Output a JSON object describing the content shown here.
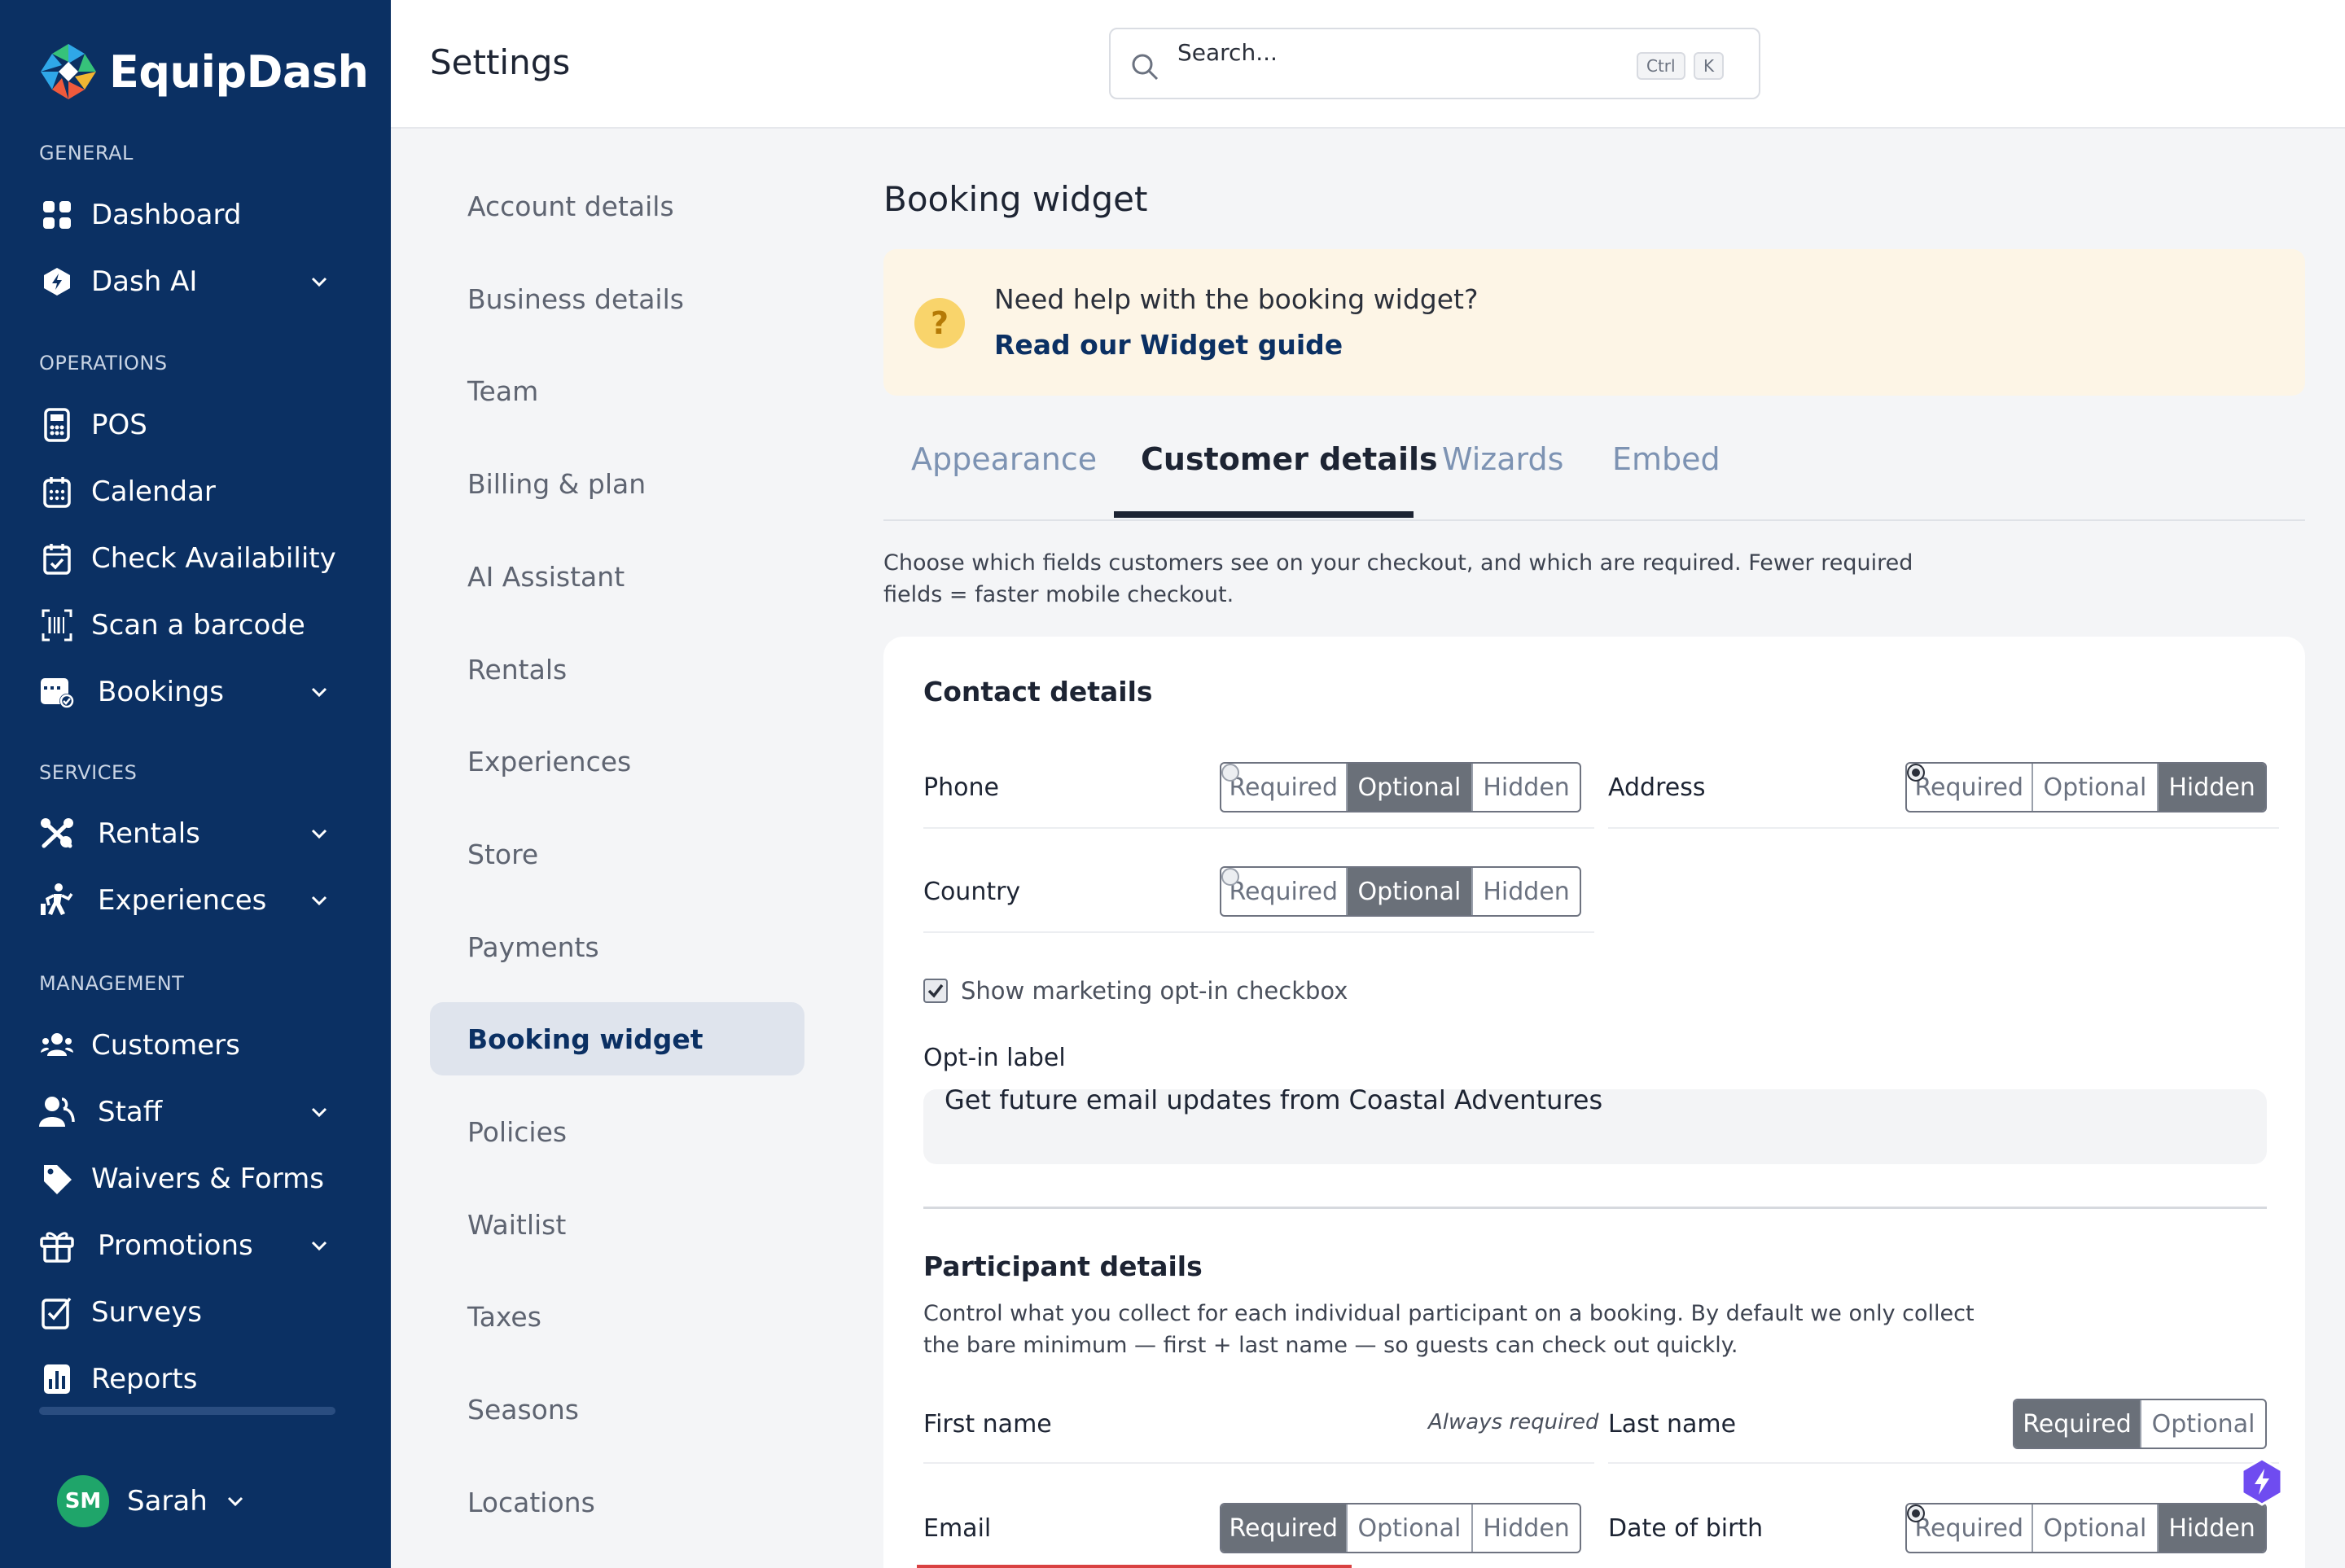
{
  "app": {
    "name": "EquipDash"
  },
  "sidebar": {
    "sections": [
      {
        "label": "GENERAL",
        "items": [
          {
            "label": "Dashboard",
            "icon": "grid-icon",
            "has_chevron": false
          },
          {
            "label": "Dash AI",
            "icon": "ai-hexagon-icon",
            "has_chevron": true
          }
        ]
      },
      {
        "label": "OPERATIONS",
        "items": [
          {
            "label": "POS",
            "icon": "pos-terminal-icon",
            "has_chevron": false
          },
          {
            "label": "Calendar",
            "icon": "calendar-icon",
            "has_chevron": false
          },
          {
            "label": "Check Availability",
            "icon": "calendar-check-icon",
            "has_chevron": false
          },
          {
            "label": "Scan a barcode",
            "icon": "barcode-scan-icon",
            "has_chevron": false
          },
          {
            "label": "Bookings",
            "icon": "bookings-icon",
            "has_chevron": true
          }
        ]
      },
      {
        "label": "SERVICES",
        "items": [
          {
            "label": "Rentals",
            "icon": "rentals-icon",
            "has_chevron": true
          },
          {
            "label": "Experiences",
            "icon": "experiences-icon",
            "has_chevron": true
          }
        ]
      },
      {
        "label": "MANAGEMENT",
        "items": [
          {
            "label": "Customers",
            "icon": "customers-icon",
            "has_chevron": false
          },
          {
            "label": "Staff",
            "icon": "staff-icon",
            "has_chevron": true
          },
          {
            "label": "Waivers & Forms",
            "icon": "tag-icon",
            "has_chevron": false
          },
          {
            "label": "Promotions",
            "icon": "gift-icon",
            "has_chevron": true
          },
          {
            "label": "Surveys",
            "icon": "survey-icon",
            "has_chevron": false
          },
          {
            "label": "Reports",
            "icon": "reports-icon",
            "has_chevron": false
          }
        ]
      }
    ],
    "user": {
      "initials": "SM",
      "name": "Sarah"
    }
  },
  "header": {
    "title": "Settings",
    "search": {
      "placeholder": "Search...",
      "shortcut": [
        "Ctrl",
        "K"
      ]
    }
  },
  "settings_nav": {
    "items": [
      "Account details",
      "Business details",
      "Team",
      "Billing & plan",
      "AI Assistant",
      "Rentals",
      "Experiences",
      "Store",
      "Payments",
      "Booking widget",
      "Policies",
      "Waitlist",
      "Taxes",
      "Seasons",
      "Locations"
    ],
    "active": "Booking widget"
  },
  "main": {
    "title": "Booking widget",
    "help": {
      "question": "Need help with the booking widget?",
      "link": "Read our Widget guide"
    },
    "tabs": [
      "Appearance",
      "Customer details",
      "Wizards",
      "Embed"
    ],
    "active_tab": "Customer details",
    "description": "Choose which fields customers see on your checkout, and which are required. Fewer required fields = faster mobile checkout.",
    "contact": {
      "title": "Contact details",
      "options": [
        "Required",
        "Optional",
        "Hidden"
      ],
      "fields": [
        {
          "label": "Phone",
          "selected": "Optional"
        },
        {
          "label": "Address",
          "selected": "Hidden"
        },
        {
          "label": "Country",
          "selected": "Optional"
        }
      ],
      "marketing_checkbox": {
        "label": "Show marketing opt-in checkbox",
        "checked": true
      },
      "optin_label": {
        "label": "Opt-in label",
        "value": "Get future email updates from Coastal Adventures"
      }
    },
    "participant": {
      "title": "Participant details",
      "description": "Control what you collect for each individual participant on a booking. By default we only collect the bare minimum — first + last name — so guests can check out quickly.",
      "fields": [
        {
          "label": "First name",
          "note": "Always required"
        },
        {
          "label": "Last name",
          "options": [
            "Required",
            "Optional"
          ],
          "selected": "Required"
        },
        {
          "label": "Email",
          "options": [
            "Required",
            "Optional",
            "Hidden"
          ],
          "selected": "Required"
        },
        {
          "label": "Date of birth",
          "options": [
            "Required",
            "Optional",
            "Hidden"
          ],
          "selected": "Hidden"
        }
      ]
    }
  },
  "colors": {
    "sidebar_bg": "#0b3063",
    "accent": "#0b3063",
    "help_bg": "#fdf5e6",
    "selected_segment": "#6a7079",
    "fab": "#6f4cf0"
  }
}
